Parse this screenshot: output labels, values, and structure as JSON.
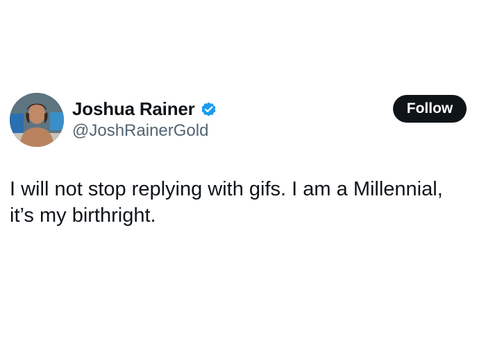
{
  "author": {
    "display_name": "Joshua Rainer",
    "handle": "@JoshRainerGold",
    "verified": true,
    "avatar_icon": "profile-photo"
  },
  "follow_button": {
    "label": "Follow"
  },
  "tweet": {
    "lines": [
      "I will not stop replying with gifs. I am a Millennial,",
      "it’s my birthright."
    ]
  },
  "colors": {
    "text_primary": "#0f1419",
    "text_secondary": "#536471",
    "verified_badge": "#1d9bf0",
    "button_bg": "#0f1419",
    "button_text": "#ffffff",
    "background": "#ffffff"
  }
}
